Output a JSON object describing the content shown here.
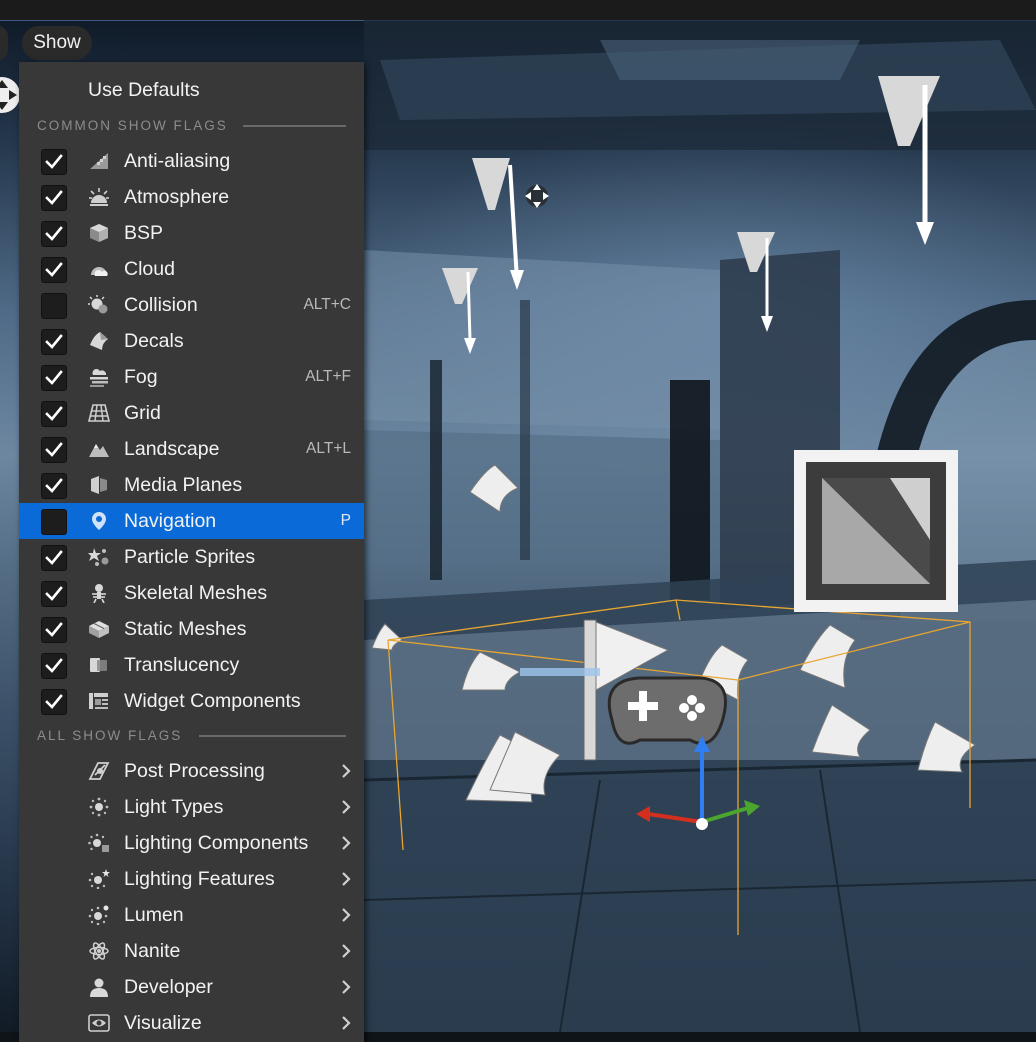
{
  "toolbar": {
    "show_label": "Show"
  },
  "menu": {
    "use_defaults_label": "Use Defaults",
    "common_header": "COMMON SHOW FLAGS",
    "all_header": "ALL SHOW FLAGS",
    "common_items": [
      {
        "label": "Anti-aliasing",
        "shortcut": "",
        "checked": true,
        "icon": "anti-aliasing-icon"
      },
      {
        "label": "Atmosphere",
        "shortcut": "",
        "checked": true,
        "icon": "atmosphere-icon"
      },
      {
        "label": "BSP",
        "shortcut": "",
        "checked": true,
        "icon": "bsp-icon"
      },
      {
        "label": "Cloud",
        "shortcut": "",
        "checked": true,
        "icon": "cloud-icon"
      },
      {
        "label": "Collision",
        "shortcut": "ALT+C",
        "checked": false,
        "icon": "collision-icon"
      },
      {
        "label": "Decals",
        "shortcut": "",
        "checked": true,
        "icon": "decals-icon"
      },
      {
        "label": "Fog",
        "shortcut": "ALT+F",
        "checked": true,
        "icon": "fog-icon"
      },
      {
        "label": "Grid",
        "shortcut": "",
        "checked": true,
        "icon": "grid-icon"
      },
      {
        "label": "Landscape",
        "shortcut": "ALT+L",
        "checked": true,
        "icon": "landscape-icon"
      },
      {
        "label": "Media Planes",
        "shortcut": "",
        "checked": true,
        "icon": "media-planes-icon"
      },
      {
        "label": "Navigation",
        "shortcut": "P",
        "checked": false,
        "icon": "navigation-pin-icon"
      },
      {
        "label": "Particle Sprites",
        "shortcut": "",
        "checked": true,
        "icon": "particle-sprites-icon"
      },
      {
        "label": "Skeletal Meshes",
        "shortcut": "",
        "checked": true,
        "icon": "skeletal-mesh-icon"
      },
      {
        "label": "Static Meshes",
        "shortcut": "",
        "checked": true,
        "icon": "static-mesh-icon"
      },
      {
        "label": "Translucency",
        "shortcut": "",
        "checked": true,
        "icon": "translucency-icon"
      },
      {
        "label": "Widget Components",
        "shortcut": "",
        "checked": true,
        "icon": "widget-components-icon"
      }
    ],
    "all_items": [
      {
        "label": "Post Processing",
        "icon": "post-processing-icon"
      },
      {
        "label": "Light Types",
        "icon": "light-types-icon"
      },
      {
        "label": "Lighting Components",
        "icon": "lighting-components-icon"
      },
      {
        "label": "Lighting Features",
        "icon": "lighting-features-icon"
      },
      {
        "label": "Lumen",
        "icon": "lumen-icon"
      },
      {
        "label": "Nanite",
        "icon": "nanite-atom-icon"
      },
      {
        "label": "Developer",
        "icon": "developer-person-icon"
      },
      {
        "label": "Visualize",
        "icon": "visualize-eye-icon"
      }
    ]
  },
  "colors": {
    "highlight": "#0a6bd8",
    "menu_bg": "#383838",
    "bounds_box": "#e7a531"
  }
}
